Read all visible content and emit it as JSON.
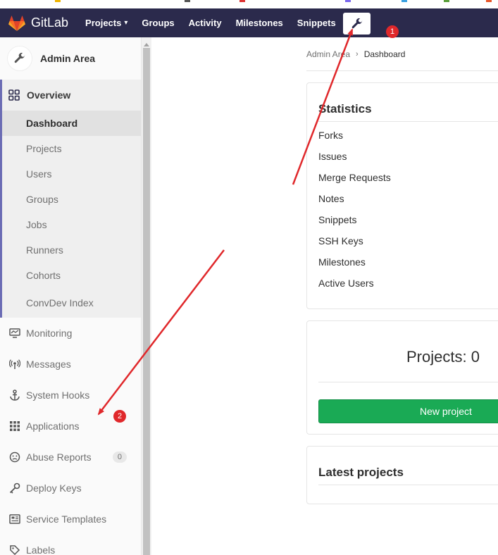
{
  "navbar": {
    "brand": "GitLab",
    "links": [
      {
        "label": "Projects"
      },
      {
        "label": "Groups"
      },
      {
        "label": "Activity"
      },
      {
        "label": "Milestones"
      },
      {
        "label": "Snippets"
      }
    ],
    "admin_icon": "wrench-icon",
    "bg": "#2b2a4c"
  },
  "sidebar": {
    "title": "Admin Area",
    "overview": {
      "label": "Overview",
      "items": [
        "Dashboard",
        "Projects",
        "Users",
        "Groups",
        "Jobs",
        "Runners",
        "Cohorts",
        "ConvDev Index"
      ],
      "active": "Dashboard"
    },
    "items": [
      {
        "label": "Monitoring",
        "icon": "monitor-icon"
      },
      {
        "label": "Messages",
        "icon": "broadcast-icon"
      },
      {
        "label": "System Hooks",
        "icon": "anchor-icon"
      },
      {
        "label": "Applications",
        "icon": "grid-icon"
      },
      {
        "label": "Abuse Reports",
        "icon": "face-icon",
        "badge": "0"
      },
      {
        "label": "Deploy Keys",
        "icon": "key-icon"
      },
      {
        "label": "Service Templates",
        "icon": "template-icon"
      },
      {
        "label": "Labels",
        "icon": "label-icon"
      }
    ]
  },
  "breadcrumb": {
    "parent": "Admin Area",
    "current": "Dashboard"
  },
  "statistics": {
    "title": "Statistics",
    "rows": [
      "Forks",
      "Issues",
      "Merge Requests",
      "Notes",
      "Snippets",
      "SSH Keys",
      "Milestones",
      "Active Users"
    ]
  },
  "projects_card": {
    "count_text": "Projects: 0",
    "button": "New project"
  },
  "latest_card": {
    "title": "Latest projects"
  },
  "annotations": {
    "badge1": "1",
    "badge2": "2",
    "color": "#e0282b"
  }
}
